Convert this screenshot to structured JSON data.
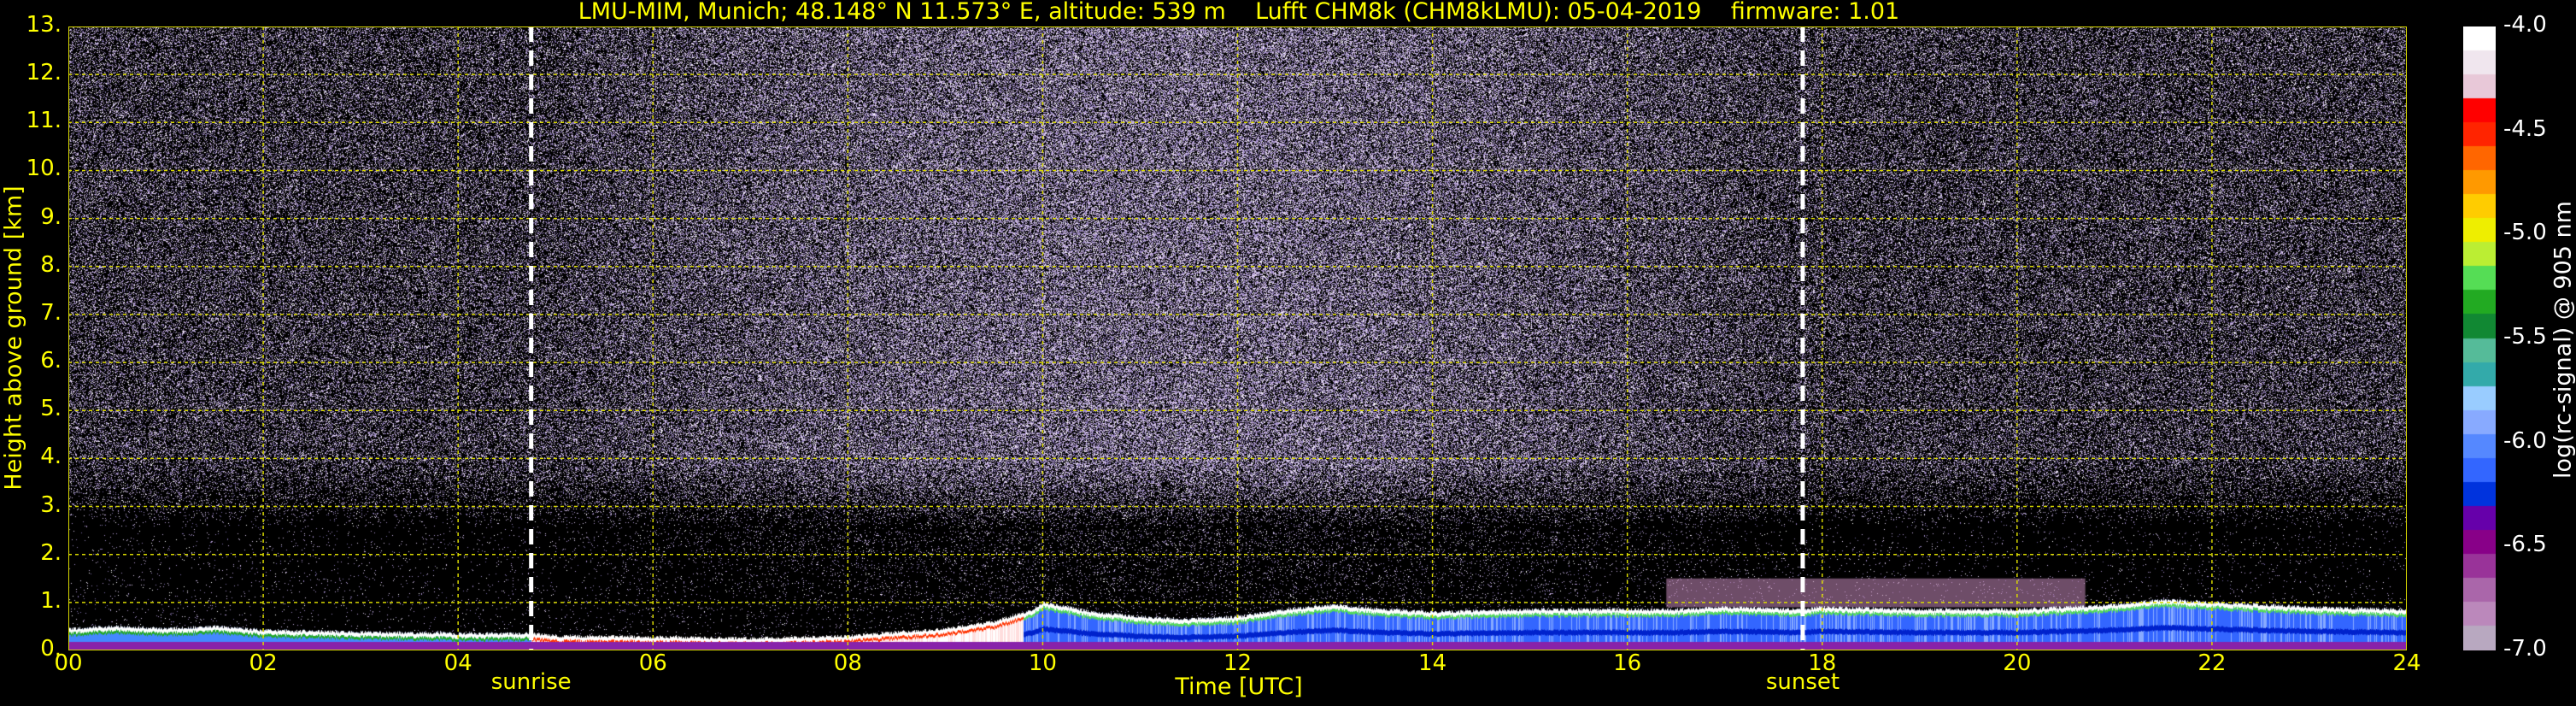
{
  "title": "LMU-MIM, Munich; 48.148° N 11.573° E, altitude: 539 m    Lufft CHM8k (CHM8kLMU): 05-04-2019    firmware: 1.01",
  "chart_data": {
    "type": "heatmap",
    "title": "LMU-MIM, Munich; 48.148° N 11.573° E, altitude: 539 m    Lufft CHM8k (CHM8kLMU): 05-04-2019    firmware: 1.01",
    "xlabel": "Time [UTC]",
    "ylabel": "Height above ground [km]",
    "xlim": [
      0,
      24
    ],
    "ylim": [
      0,
      13
    ],
    "x_ticks": [
      "00",
      "02",
      "04",
      "06",
      "08",
      "10",
      "12",
      "14",
      "16",
      "18",
      "20",
      "22",
      "24"
    ],
    "y_ticks": [
      "0.",
      "1.",
      "2.",
      "3.",
      "4.",
      "5.",
      "6.",
      "7.",
      "8.",
      "9.",
      "10.",
      "11.",
      "12.",
      "13."
    ],
    "grid": true,
    "markers": [
      {
        "label": "sunrise",
        "x": 4.75
      },
      {
        "label": "sunset",
        "x": 17.8
      }
    ],
    "colorbar": {
      "label": "log(rc-signal) @ 905 nm",
      "range": [
        -7.0,
        -4.0
      ],
      "ticks": [
        "-4.0",
        "-4.5",
        "-5.0",
        "-5.5",
        "-6.0",
        "-6.5",
        "-7.0"
      ],
      "colors": [
        "#ffffff",
        "#f0e6ee",
        "#e8c8d8",
        "#ff0000",
        "#ff2400",
        "#ff6600",
        "#ff9900",
        "#ffcc00",
        "#eeee00",
        "#bbee33",
        "#55dd55",
        "#22aa22",
        "#118833",
        "#55bb99",
        "#33aaaa",
        "#99ccff",
        "#88aaff",
        "#5588ff",
        "#3366ff",
        "#0033dd",
        "#6600aa",
        "#880088",
        "#993399",
        "#aa66aa",
        "#bb88bb",
        "#b8a8c0"
      ]
    },
    "boundary_layer_top_km": [
      [
        0,
        0.45
      ],
      [
        0.5,
        0.5
      ],
      [
        1.0,
        0.45
      ],
      [
        1.5,
        0.5
      ],
      [
        2,
        0.42
      ],
      [
        3,
        0.38
      ],
      [
        4,
        0.35
      ],
      [
        4.75,
        0.35
      ],
      [
        5,
        0.3
      ],
      [
        6,
        0.28
      ],
      [
        7,
        0.25
      ],
      [
        8,
        0.3
      ],
      [
        9,
        0.45
      ],
      [
        9.5,
        0.6
      ],
      [
        9.9,
        0.85
      ],
      [
        10,
        1.0
      ],
      [
        10.5,
        0.8
      ],
      [
        11,
        0.7
      ],
      [
        11.5,
        0.65
      ],
      [
        12,
        0.7
      ],
      [
        12.5,
        0.85
      ],
      [
        13,
        0.95
      ],
      [
        13.5,
        0.85
      ],
      [
        14,
        0.8
      ],
      [
        15,
        0.85
      ],
      [
        16,
        0.85
      ],
      [
        16.5,
        0.85
      ],
      [
        17,
        0.9
      ],
      [
        17.8,
        0.85
      ],
      [
        18,
        0.9
      ],
      [
        19,
        0.85
      ],
      [
        20,
        0.85
      ],
      [
        20.5,
        0.9
      ],
      [
        21,
        0.95
      ],
      [
        21.5,
        1.05
      ],
      [
        22,
        1.0
      ],
      [
        23,
        0.9
      ],
      [
        24,
        0.85
      ]
    ],
    "aerosol_layer_km": [
      {
        "x_start": 16.4,
        "x_end": 20.7,
        "top": 1.5,
        "base": 0.9
      }
    ]
  }
}
